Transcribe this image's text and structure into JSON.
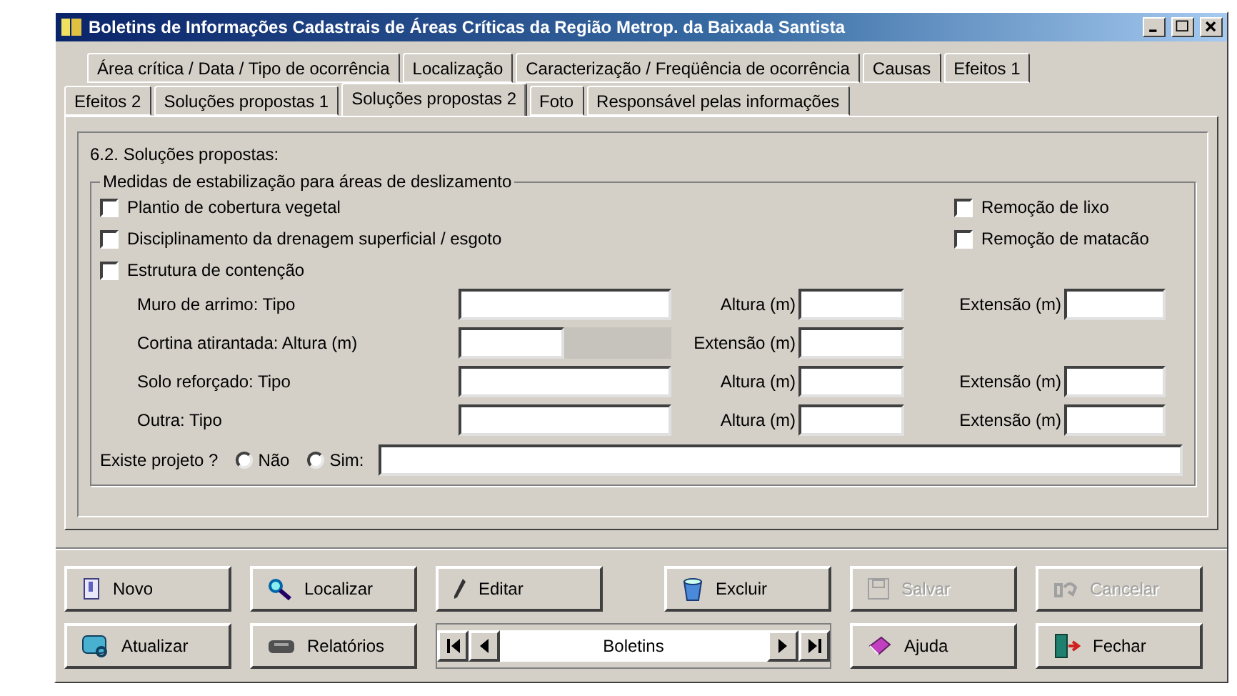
{
  "window": {
    "title": "Boletins de Informações Cadastrais de Áreas Críticas da Região Metrop. da Baixada Santista"
  },
  "tab_rows": [
    {
      "tabs": [
        {
          "label": "Área crítica / Data / Tipo de ocorrência",
          "selected": false
        },
        {
          "label": "Localização",
          "selected": false
        },
        {
          "label": "Caracterização / Freqüência de ocorrência",
          "selected": false
        },
        {
          "label": "Causas",
          "selected": false
        },
        {
          "label": "Efeitos 1",
          "selected": false
        }
      ]
    },
    {
      "tabs": [
        {
          "label": "Efeitos 2",
          "selected": false
        },
        {
          "label": "Soluções propostas 1",
          "selected": false
        },
        {
          "label": "Soluções propostas 2",
          "selected": true
        },
        {
          "label": "Foto",
          "selected": false
        },
        {
          "label": "Responsável pelas informações",
          "selected": false
        }
      ]
    }
  ],
  "section": {
    "title": "6.2. Soluções propostas:",
    "group_title": "Medidas de estabilização para áreas de deslizamento",
    "checks_left": [
      {
        "label": "Plantio de cobertura vegetal",
        "checked": false
      },
      {
        "label": "Disciplinamento da drenagem superficial / esgoto",
        "checked": false
      },
      {
        "label": "Estrutura de contenção",
        "checked": false
      }
    ],
    "checks_right": [
      {
        "label": "Remoção de lixo",
        "checked": false
      },
      {
        "label": "Remoção de matacão",
        "checked": false
      }
    ],
    "rows": [
      {
        "kind": "full",
        "label": "Muro de arrimo: Tipo",
        "height_label": "Altura (m)",
        "length_label": "Extensão (m)"
      },
      {
        "kind": "short",
        "label": "Cortina atirantada: Altura (m)",
        "length_label": "Extensão (m)"
      },
      {
        "kind": "full",
        "label": "Solo reforçado: Tipo",
        "height_label": "Altura (m)",
        "length_label": "Extensão (m)"
      },
      {
        "kind": "full",
        "label": "Outra: Tipo",
        "height_label": "Altura (m)",
        "length_label": "Extensão (m)"
      }
    ],
    "project": {
      "label": "Existe projeto ?",
      "options": [
        {
          "label": "Não",
          "selected": false
        },
        {
          "label": "Sim:",
          "selected": false
        }
      ]
    }
  },
  "buttons_top": [
    {
      "kind": "new",
      "label": "Novo",
      "disabled": false
    },
    {
      "kind": "find",
      "label": "Localizar",
      "disabled": false
    },
    {
      "kind": "edit",
      "label": "Editar",
      "disabled": false
    },
    {
      "kind": "delete",
      "label": "Excluir",
      "disabled": false
    },
    {
      "kind": "save",
      "label": "Salvar",
      "disabled": true
    },
    {
      "kind": "cancel",
      "label": "Cancelar",
      "disabled": true
    }
  ],
  "buttons_bottom_left": [
    {
      "kind": "refresh",
      "label": "Atualizar",
      "disabled": false
    },
    {
      "kind": "reports",
      "label": "Relatórios",
      "disabled": false
    }
  ],
  "navigator": {
    "label": "Boletins"
  },
  "buttons_bottom_right": [
    {
      "kind": "help",
      "label": "Ajuda",
      "disabled": false
    },
    {
      "kind": "exit",
      "label": "Fechar",
      "disabled": false
    }
  ]
}
